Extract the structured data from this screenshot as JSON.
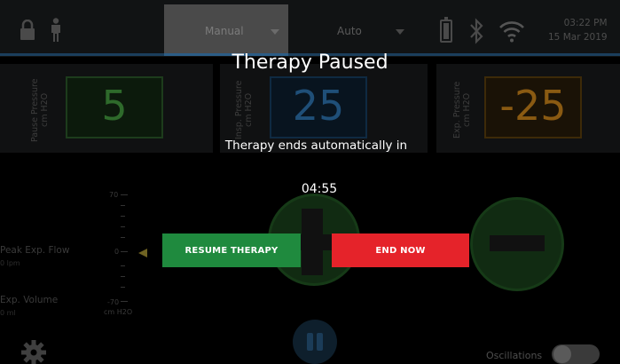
{
  "header": {
    "tab_manual": "Manual",
    "tab_auto": "Auto",
    "time": "03:22 PM",
    "date": "15 Mar 2019",
    "icons": [
      "lock-icon",
      "person-icon",
      "battery-icon",
      "bluetooth-icon",
      "wifi-icon"
    ]
  },
  "panels": [
    {
      "label": "Pause Pressure",
      "unit": "cm H2O",
      "value": "5",
      "color": "#2e6a2b"
    },
    {
      "label": "Insp. Pressure",
      "unit": "cm H2O",
      "value": "25",
      "color": "#1f4f78"
    },
    {
      "label": "Exp. Pressure",
      "unit": "cm H2O",
      "value": "-25",
      "color": "#8a5a12"
    }
  ],
  "gauge": {
    "peak_label": "Peak Exp. Flow",
    "peak_value": "0 lpm",
    "volume_label": "Exp. Volume",
    "volume_value": "0 ml",
    "tick_top": "70",
    "tick_mid": "0",
    "tick_bottom": "-70",
    "unit": "cm H2O"
  },
  "footer": {
    "oscillations_label": "Oscillations"
  },
  "dialog": {
    "title": "Therapy Paused",
    "message": "Therapy ends automatically in",
    "countdown": "04:55",
    "resume_label": "RESUME THERAPY",
    "end_label": "END NOW"
  },
  "colors": {
    "resume": "#1f8a3e",
    "end": "#e5232a",
    "accent": "#1b3e5c"
  }
}
